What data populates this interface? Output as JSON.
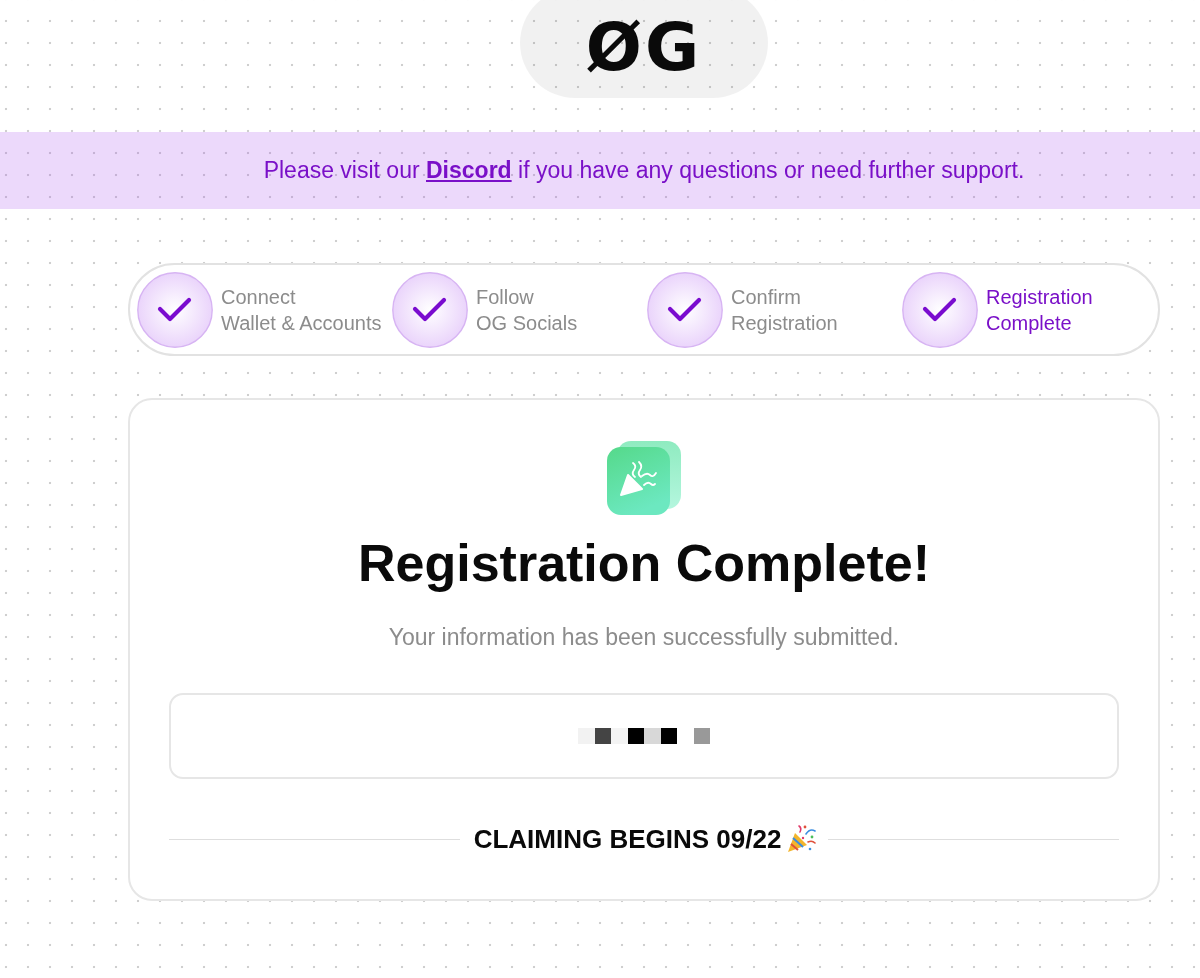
{
  "logo": {
    "text": "ØG"
  },
  "notice": {
    "before": "Please visit our",
    "link": "Discord",
    "after": "if you have any questions or need further support."
  },
  "steps": [
    {
      "lines": [
        "Connect",
        "Wallet & Accounts"
      ],
      "completed": true,
      "selected": false
    },
    {
      "lines": [
        "Follow",
        "OG Socials"
      ],
      "completed": true,
      "selected": false
    },
    {
      "lines": [
        "Confirm",
        "Registration"
      ],
      "completed": true,
      "selected": false
    },
    {
      "lines": [
        "Registration",
        "Complete"
      ],
      "completed": true,
      "selected": true
    }
  ],
  "card": {
    "title": "Registration Complete!",
    "message": "Your information has been successfully submitted.",
    "claim_notice": "CLAIMING BEGINS 09/22"
  }
}
